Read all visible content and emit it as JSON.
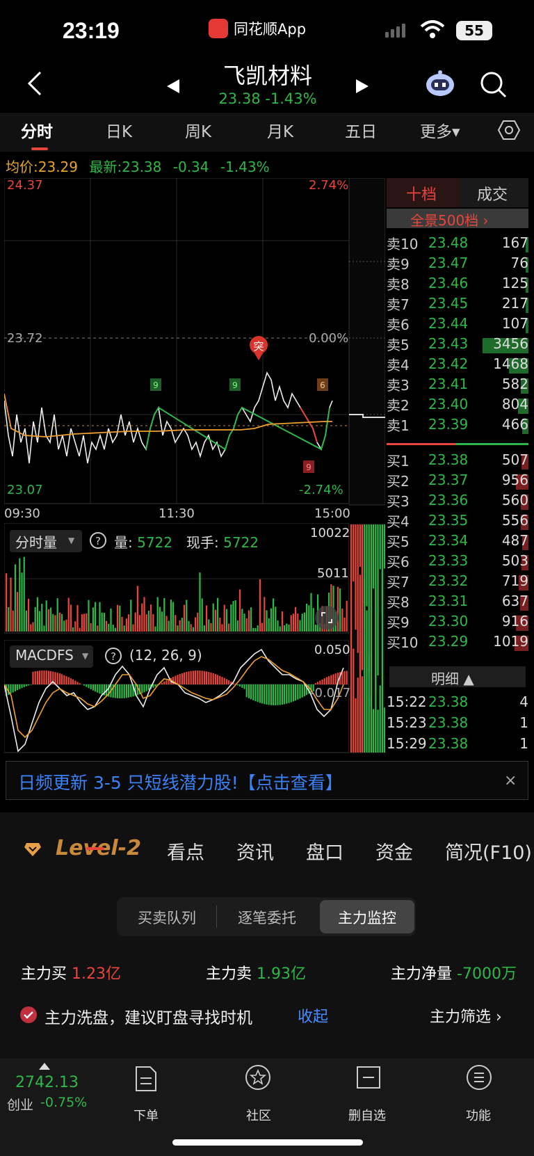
{
  "status": {
    "time": "23:19",
    "app": "同花顺App",
    "battery": "55"
  },
  "header": {
    "title": "飞凯材料",
    "price": "23.38",
    "change_pct": "-1.43%"
  },
  "tabs": [
    "分时",
    "日K",
    "周K",
    "月K",
    "五日",
    "更多▾"
  ],
  "info": {
    "avg_label": "均价:",
    "avg": "23.29",
    "latest_label": "最新:",
    "latest": "23.38",
    "change": "-0.34",
    "change_pct": "-1.43%"
  },
  "price_chart": {
    "high": "24.37",
    "high_pct": "2.74%",
    "mid": "23.72",
    "mid_pct": "0.00%",
    "low": "23.07",
    "low_pct": "-2.74%",
    "times": [
      "09:30",
      "11:30",
      "15:00"
    ],
    "marker_tu": "突",
    "marker_9a": "9",
    "marker_9b": "9",
    "marker_9c": "9",
    "marker_6": "6"
  },
  "volume": {
    "label": "分时量",
    "vol_label": "量:",
    "vol": "5722",
    "hand_label": "现手:",
    "hand": "5722",
    "max": "10022",
    "mid": "5011"
  },
  "macd": {
    "label": "MACDFS",
    "params": "(12, 26, 9)",
    "top": "0.050",
    "bottom": "-0.017"
  },
  "orderbook": {
    "tab_ten": "十档",
    "tab_deal": "成交",
    "panorama": "全景500档 ›",
    "sells": [
      [
        "卖10",
        "23.48",
        "167",
        0.05
      ],
      [
        "卖9",
        "23.47",
        "76",
        0.02
      ],
      [
        "卖8",
        "23.46",
        "125",
        0.04
      ],
      [
        "卖7",
        "23.45",
        "217",
        0.06
      ],
      [
        "卖6",
        "23.44",
        "107",
        0.03
      ],
      [
        "卖5",
        "23.43",
        "3456",
        1.0
      ],
      [
        "卖4",
        "23.42",
        "1468",
        0.42
      ],
      [
        "卖3",
        "23.41",
        "582",
        0.17
      ],
      [
        "卖2",
        "23.40",
        "804",
        0.23
      ],
      [
        "卖1",
        "23.39",
        "466",
        0.13
      ]
    ],
    "buys": [
      [
        "买1",
        "23.38",
        "507",
        0.15
      ],
      [
        "买2",
        "23.37",
        "956",
        0.28
      ],
      [
        "买3",
        "23.36",
        "560",
        0.16
      ],
      [
        "买4",
        "23.35",
        "556",
        0.16
      ],
      [
        "买5",
        "23.34",
        "487",
        0.14
      ],
      [
        "买6",
        "23.33",
        "503",
        0.15
      ],
      [
        "买7",
        "23.32",
        "719",
        0.21
      ],
      [
        "买8",
        "23.31",
        "637",
        0.18
      ],
      [
        "买9",
        "23.30",
        "916",
        0.27
      ],
      [
        "买10",
        "23.29",
        "1019",
        0.3
      ]
    ],
    "detail_label": "明细 ▲",
    "details": [
      [
        "15:22",
        "23.38",
        "4"
      ],
      [
        "15:23",
        "23.38",
        "1"
      ],
      [
        "15:29",
        "23.38",
        "1"
      ]
    ]
  },
  "banner": {
    "text": "日频更新 3-5 只短线潜力股!【点击查看】",
    "close": "×"
  },
  "lower": {
    "logo": "Level-2",
    "tabs": [
      "看点",
      "资讯",
      "盘口",
      "资金",
      "简况(F10)"
    ],
    "seg": [
      "买卖队列",
      "逐笔委托",
      "主力监控"
    ],
    "main_buy_label": "主力买",
    "main_buy": "1.23亿",
    "main_sell_label": "主力卖",
    "main_sell": "1.93亿",
    "net_label": "主力净量",
    "net": "-7000万",
    "tip": "主力洗盘，建议盯盘寻找时机",
    "collapse": "收起",
    "filter": "主力筛选 ›"
  },
  "footer": {
    "index_value": "2742.13",
    "index_name": "创业",
    "index_pct": "-0.75%",
    "items": [
      "下单",
      "社区",
      "删自选",
      "功能"
    ]
  }
}
